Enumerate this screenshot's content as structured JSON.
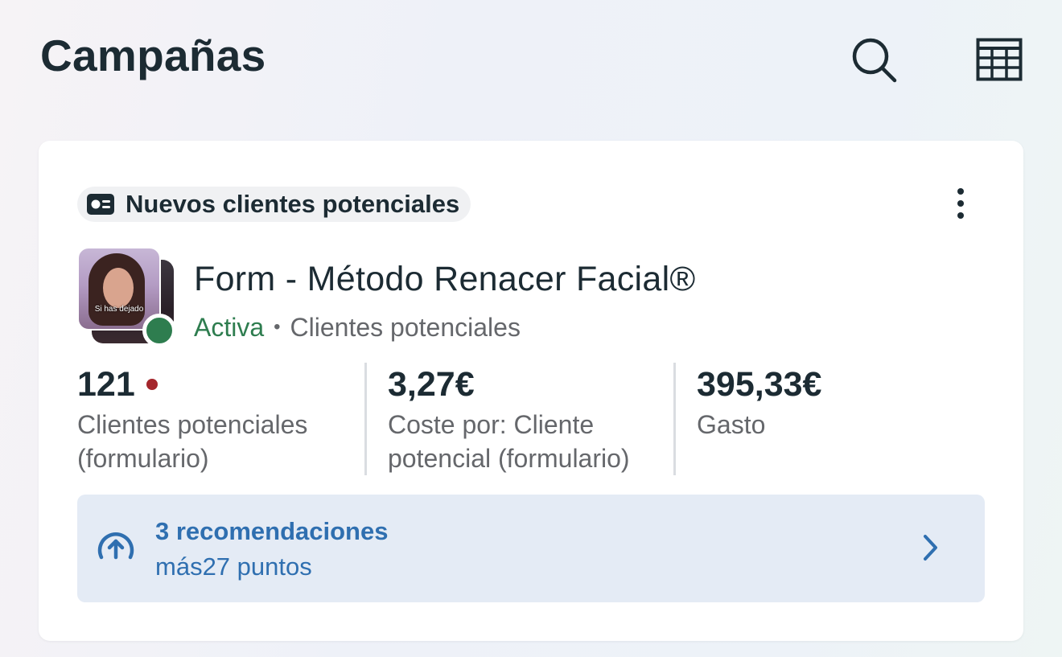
{
  "header": {
    "title": "Campañas"
  },
  "campaign": {
    "objective_label": "Nuevos clientes potenciales",
    "name": "Form - Método Renacer Facial®",
    "status": "Activa",
    "separator": "•",
    "objective_type": "Clientes potenciales",
    "thumbnail_caption": "Si has dejado",
    "metrics": [
      {
        "value": "121",
        "label_line1": "Clientes potenciales",
        "label_line2": "(formulario)"
      },
      {
        "value": "3,27€",
        "label_line1": "Coste por: Cliente",
        "label_line2": "potencial (formulario)"
      },
      {
        "value": "395,33€",
        "label_line1": "Gasto",
        "label_line2": ""
      }
    ],
    "recommendations": {
      "title": "3 recomendaciones",
      "subtitle": "más27 puntos"
    }
  },
  "colors": {
    "status_active": "#2e7d4f",
    "alert": "#a4262c",
    "link_blue": "#2f6fb0",
    "recs_background": "#e4ebf5"
  },
  "icons": {
    "search": "search-icon",
    "table": "table-icon",
    "objective": "lead-form-icon",
    "more": "more-vertical-icon",
    "recommendations": "arrow-up-circle-icon",
    "chevron": "chevron-right-icon"
  }
}
